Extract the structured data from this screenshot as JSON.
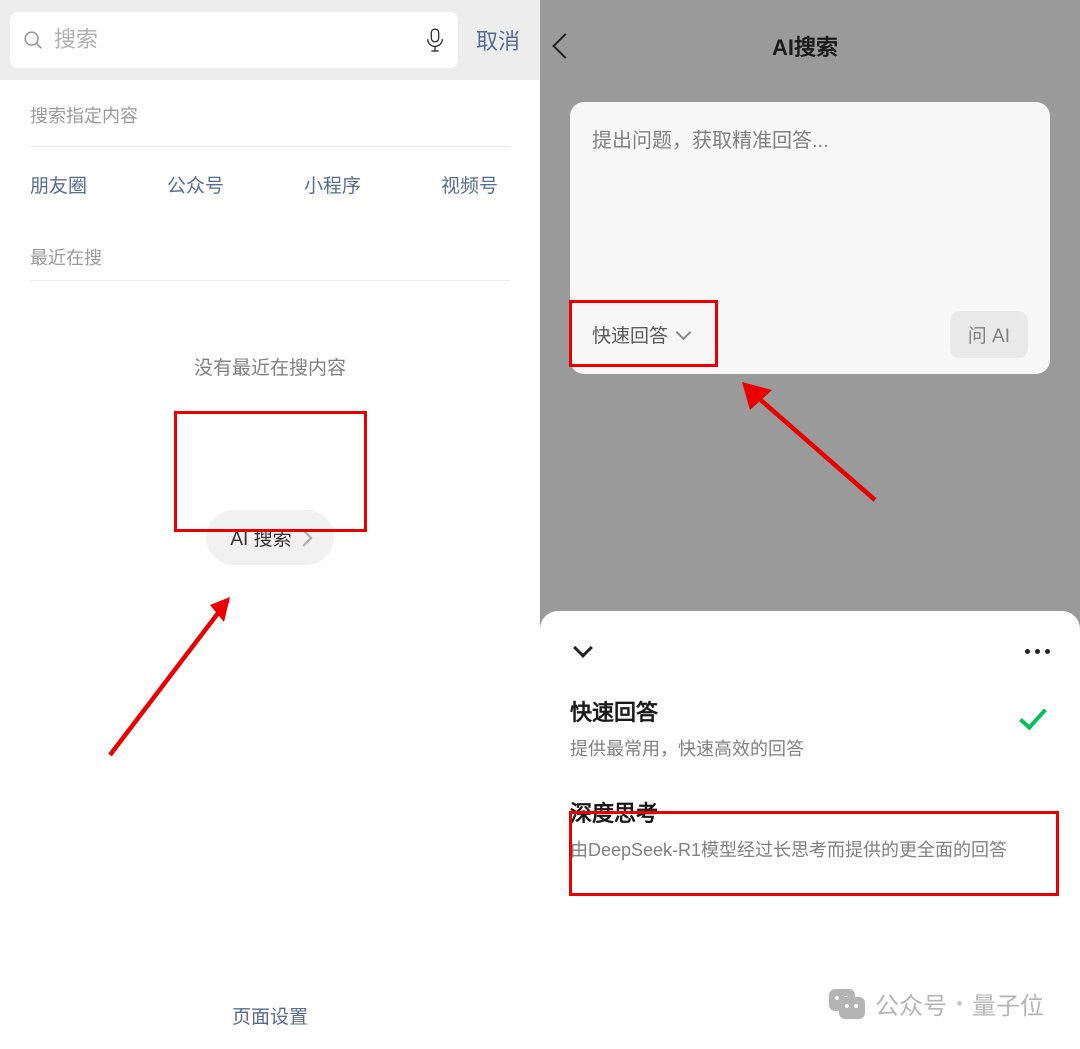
{
  "left": {
    "search_placeholder": "搜索",
    "cancel": "取消",
    "section_specified": "搜索指定内容",
    "links": [
      "朋友圈",
      "公众号",
      "小程序",
      "视频号"
    ],
    "recent_title": "最近在搜",
    "no_recent": "没有最近在搜内容",
    "ai_search_btn": "AI 搜索",
    "page_settings": "页面设置"
  },
  "right": {
    "title": "AI搜索",
    "prompt_placeholder": "提出问题，获取精准回答...",
    "mode_label": "快速回答",
    "ask_btn": "问 AI"
  },
  "sheet": {
    "opt1_title": "快速回答",
    "opt1_desc": "提供最常用，快速高效的回答",
    "opt2_title": "深度思考",
    "opt2_desc": "由DeepSeek-R1模型经过长思考而提供的更全面的回答"
  },
  "watermark": {
    "label1": "公众号",
    "label2": "量子位"
  }
}
